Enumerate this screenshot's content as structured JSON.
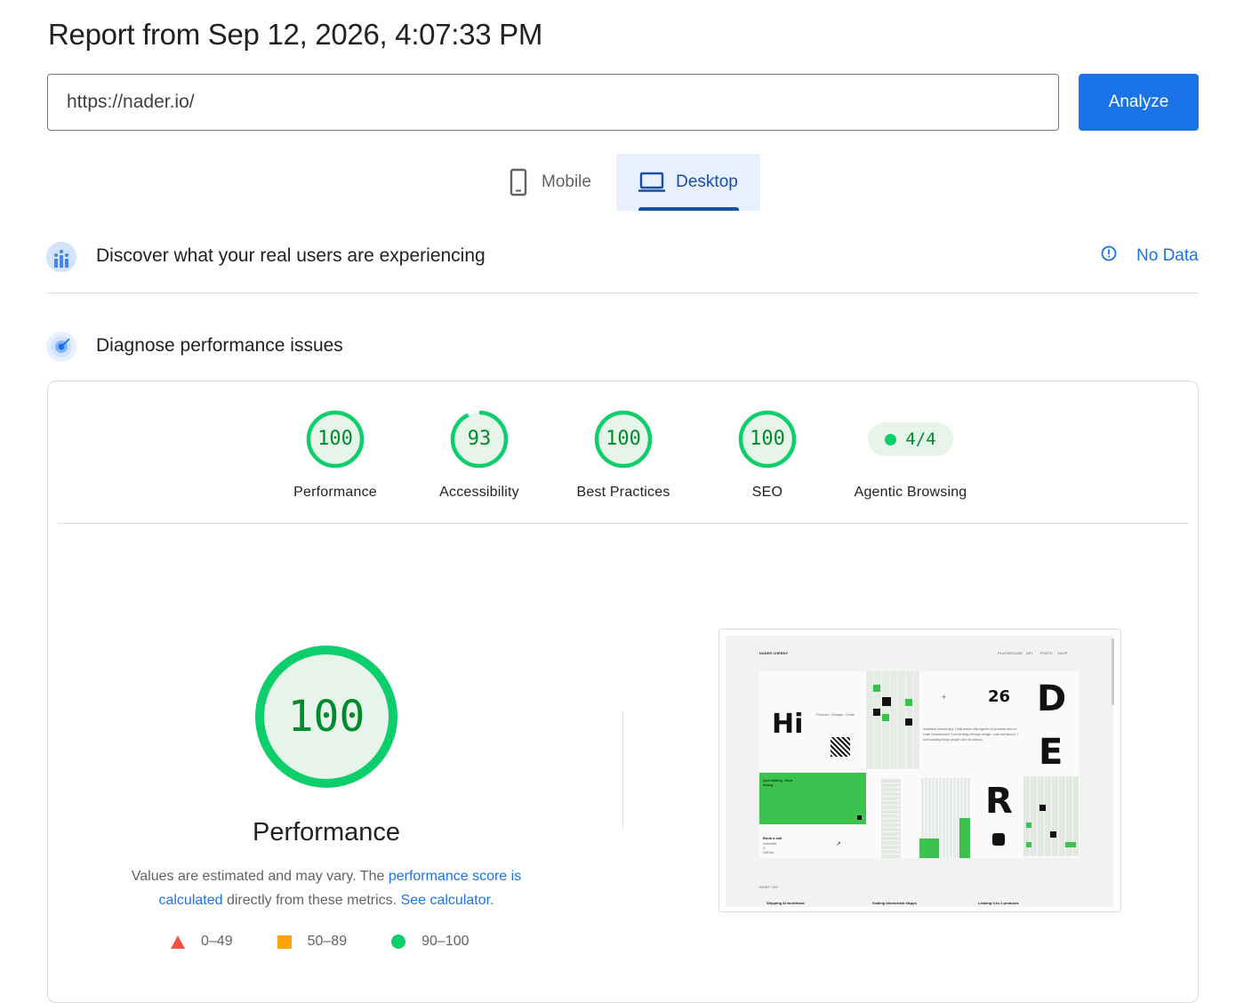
{
  "report": {
    "title": "Report from Sep 12, 2026, 4:07:33 PM"
  },
  "search": {
    "url": "https://nader.io/",
    "analyze_label": "Analyze"
  },
  "tabs": {
    "mobile": "Mobile",
    "desktop": "Desktop",
    "active": "Desktop"
  },
  "field_data": {
    "title": "Discover what your real users are experiencing",
    "status": "No Data"
  },
  "lab": {
    "title": "Diagnose performance issues"
  },
  "scores": [
    {
      "label": "Performance",
      "value": "100",
      "fraction": 1.0
    },
    {
      "label": "Accessibility",
      "value": "93",
      "fraction": 0.93
    },
    {
      "label": "Best Practices",
      "value": "100",
      "fraction": 1.0
    },
    {
      "label": "SEO",
      "value": "100",
      "fraction": 1.0
    }
  ],
  "agentic": {
    "label": "Agentic Browsing",
    "value": "4/4"
  },
  "performance_detail": {
    "score": "100",
    "label": "Performance",
    "desc_prefix": "Values are estimated and may vary. The ",
    "desc_link1": "performance score is calculated",
    "desc_middle": " directly from these metrics. ",
    "desc_link2": "See calculator."
  },
  "legend": [
    {
      "range": "0–49",
      "shape": "triangle",
      "color": "#ff4e42"
    },
    {
      "range": "50–89",
      "shape": "square",
      "color": "#ffa400"
    },
    {
      "range": "90–100",
      "shape": "circle",
      "color": "#0cce6b"
    }
  ],
  "screenshot": {
    "site_name": "NADER CHERNY",
    "nav": [
      "PLAYGROUND",
      "ART",
      "POSTS",
      "SHOP"
    ],
    "hi": "Hi",
    "number": "26",
    "letters": [
      "D",
      "E",
      "R"
    ],
    "tagline": "Product · Design · Code",
    "green_text": "Quit talking. Start doing.",
    "about": "Analytical product guy. I help teams ship agentic AI products and on-chain infrastructure, from strategy through design, code and launch. I love building things people can't do without.",
    "book": "Book a call",
    "links": [
      "LinkedIn",
      "X",
      "GitHub"
    ],
    "section": "WHAT I DO",
    "footer": [
      "Shipping AI workflows",
      "Scaling blockchain dApps",
      "Leading 0-to-1 products"
    ]
  },
  "colors": {
    "accent": "#1a73e8",
    "pass": "#0cce6b",
    "pass_text": "#008a2e"
  }
}
